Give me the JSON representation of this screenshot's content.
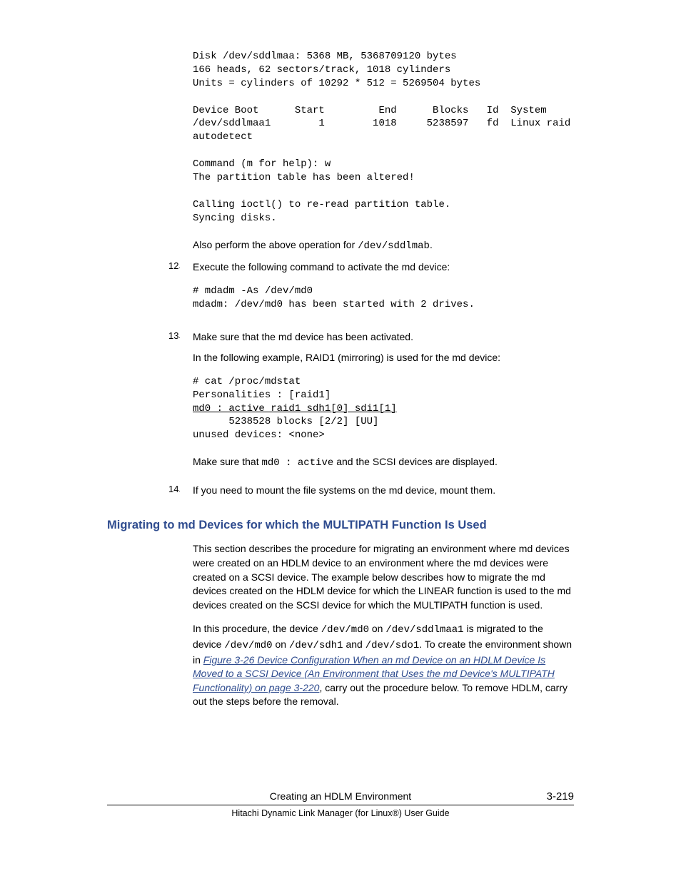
{
  "code1": "Disk /dev/sddlmaa: 5368 MB, 5368709120 bytes\n166 heads, 62 sectors/track, 1018 cylinders\nUnits = cylinders of 10292 * 512 = 5269504 bytes\n\nDevice Boot      Start         End      Blocks   Id  System\n/dev/sddlmaa1        1        1018     5238597   fd  Linux raid\nautodetect\n\nCommand (m for help): w\nThe partition table has been altered!\n\nCalling ioctl() to re-read partition table.\nSyncing disks.",
  "p_also_1": "Also perform the above operation for ",
  "p_also_code": "/dev/sddlmab",
  "p_also_2": ".",
  "step12_num": "12",
  "step12_text": "Execute the following command to activate the md device:",
  "code2": "# mdadm -As /dev/md0\nmdadm: /dev/md0 has been started with 2 drives.",
  "step13_num": "13",
  "step13_text1": "Make sure that the md device has been activated.",
  "step13_text2": "In the following example, RAID1 (mirroring) is used for the md device:",
  "code3_l1": "# cat /proc/mdstat",
  "code3_l2": "Personalities : [raid1]",
  "code3_l3": "md0 : active raid1 sdh1[0] sdi1[1]",
  "code3_l4": "      5238528 blocks [2/2] [UU]",
  "code3_l5": "unused devices: <none>",
  "p_make_1": "Make sure that ",
  "p_make_code": "md0 : active",
  "p_make_2": " and the SCSI devices are displayed.",
  "step14_num": "14",
  "step14_text": "If you need to mount the file systems on the md device, mount them.",
  "heading": "Migrating to md Devices for which the MULTIPATH Function Is Used",
  "para1": "This section describes the procedure for migrating an environment where md devices were created on an HDLM device to an environment where the md devices were created on a SCSI device. The example below describes how to migrate the md devices created on the HDLM device for which the LINEAR function is used to the md devices created on the SCSI device for which the MULTIPATH function is used.",
  "para2_1": "In this procedure, the device ",
  "para2_c1": "/dev/md0",
  "para2_2": " on ",
  "para2_c2": "/dev/sddlmaa1",
  "para2_3": " is migrated to the device ",
  "para2_c3": "/dev/md0",
  "para2_4": " on ",
  "para2_c4": "/dev/sdh1",
  "para2_5": " and ",
  "para2_c5": "/dev/sdo1",
  "para2_6": ". To create the environment shown in ",
  "para2_link": "Figure 3-26 Device Configuration When an md Device on an HDLM Device Is Moved to a SCSI Device (An Environment that Uses the md Device's MULTIPATH Functionality) on page 3-220",
  "para2_7": ", carry out the procedure below. To remove HDLM, carry out the steps before the removal.",
  "footer_title": "Creating an HDLM Environment",
  "footer_sub": "Hitachi Dynamic Link Manager (for Linux®) User Guide",
  "page_num": "3-219"
}
